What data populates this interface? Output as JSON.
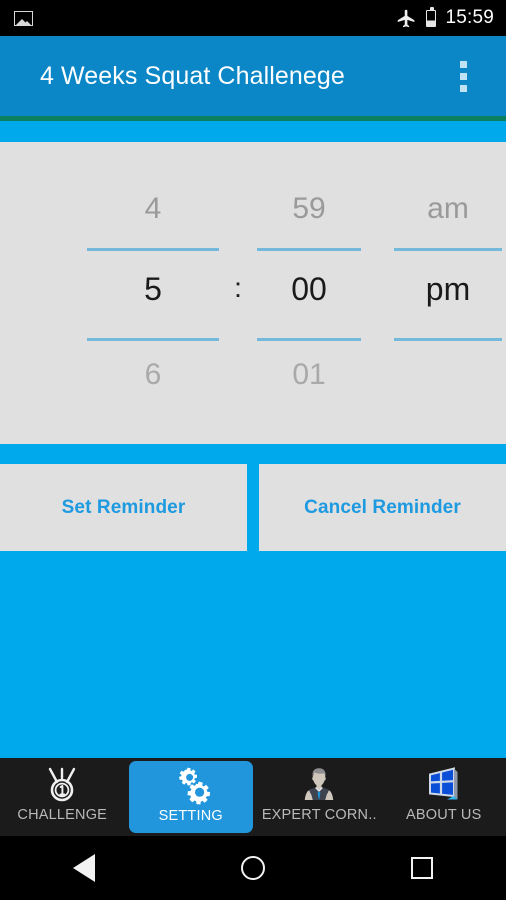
{
  "status_bar": {
    "left_icon": "image-icon",
    "airplane_icon": "airplane-mode-icon",
    "battery_icon": "battery-icon",
    "time": "15:59"
  },
  "app_bar": {
    "title": "4 Weeks Squat Challenege",
    "overflow_icon": "overflow-menu-icon",
    "background_color": "#0b86c6",
    "accent_line_color": "#0b7f5e"
  },
  "time_picker": {
    "hour": {
      "previous": "4",
      "selected": "5",
      "next": "6"
    },
    "minute": {
      "previous": "59",
      "selected": "00",
      "next": "01"
    },
    "meridiem": {
      "previous": "am",
      "selected": "pm",
      "next": ""
    },
    "separator": ":",
    "divider_color": "#74b8dc",
    "panel_color": "#e0e0e0"
  },
  "actions": {
    "set_label": "Set Reminder",
    "cancel_label": "Cancel Reminder",
    "text_color": "#1e9ae0"
  },
  "theme": {
    "cyan": "#00a8ec",
    "tab_active": "#2196dd"
  },
  "tabs": [
    {
      "label": "CHALLENGE",
      "icon": "medal-icon",
      "active": false
    },
    {
      "label": "SETTING",
      "icon": "gears-icon",
      "active": true
    },
    {
      "label": "EXPERT CORN..",
      "icon": "businessman-icon",
      "active": false
    },
    {
      "label": "ABOUT US",
      "icon": "window-logo-icon",
      "active": false
    }
  ],
  "nav_bar": {
    "back": "back-icon",
    "home": "home-icon",
    "recents": "recents-icon"
  }
}
